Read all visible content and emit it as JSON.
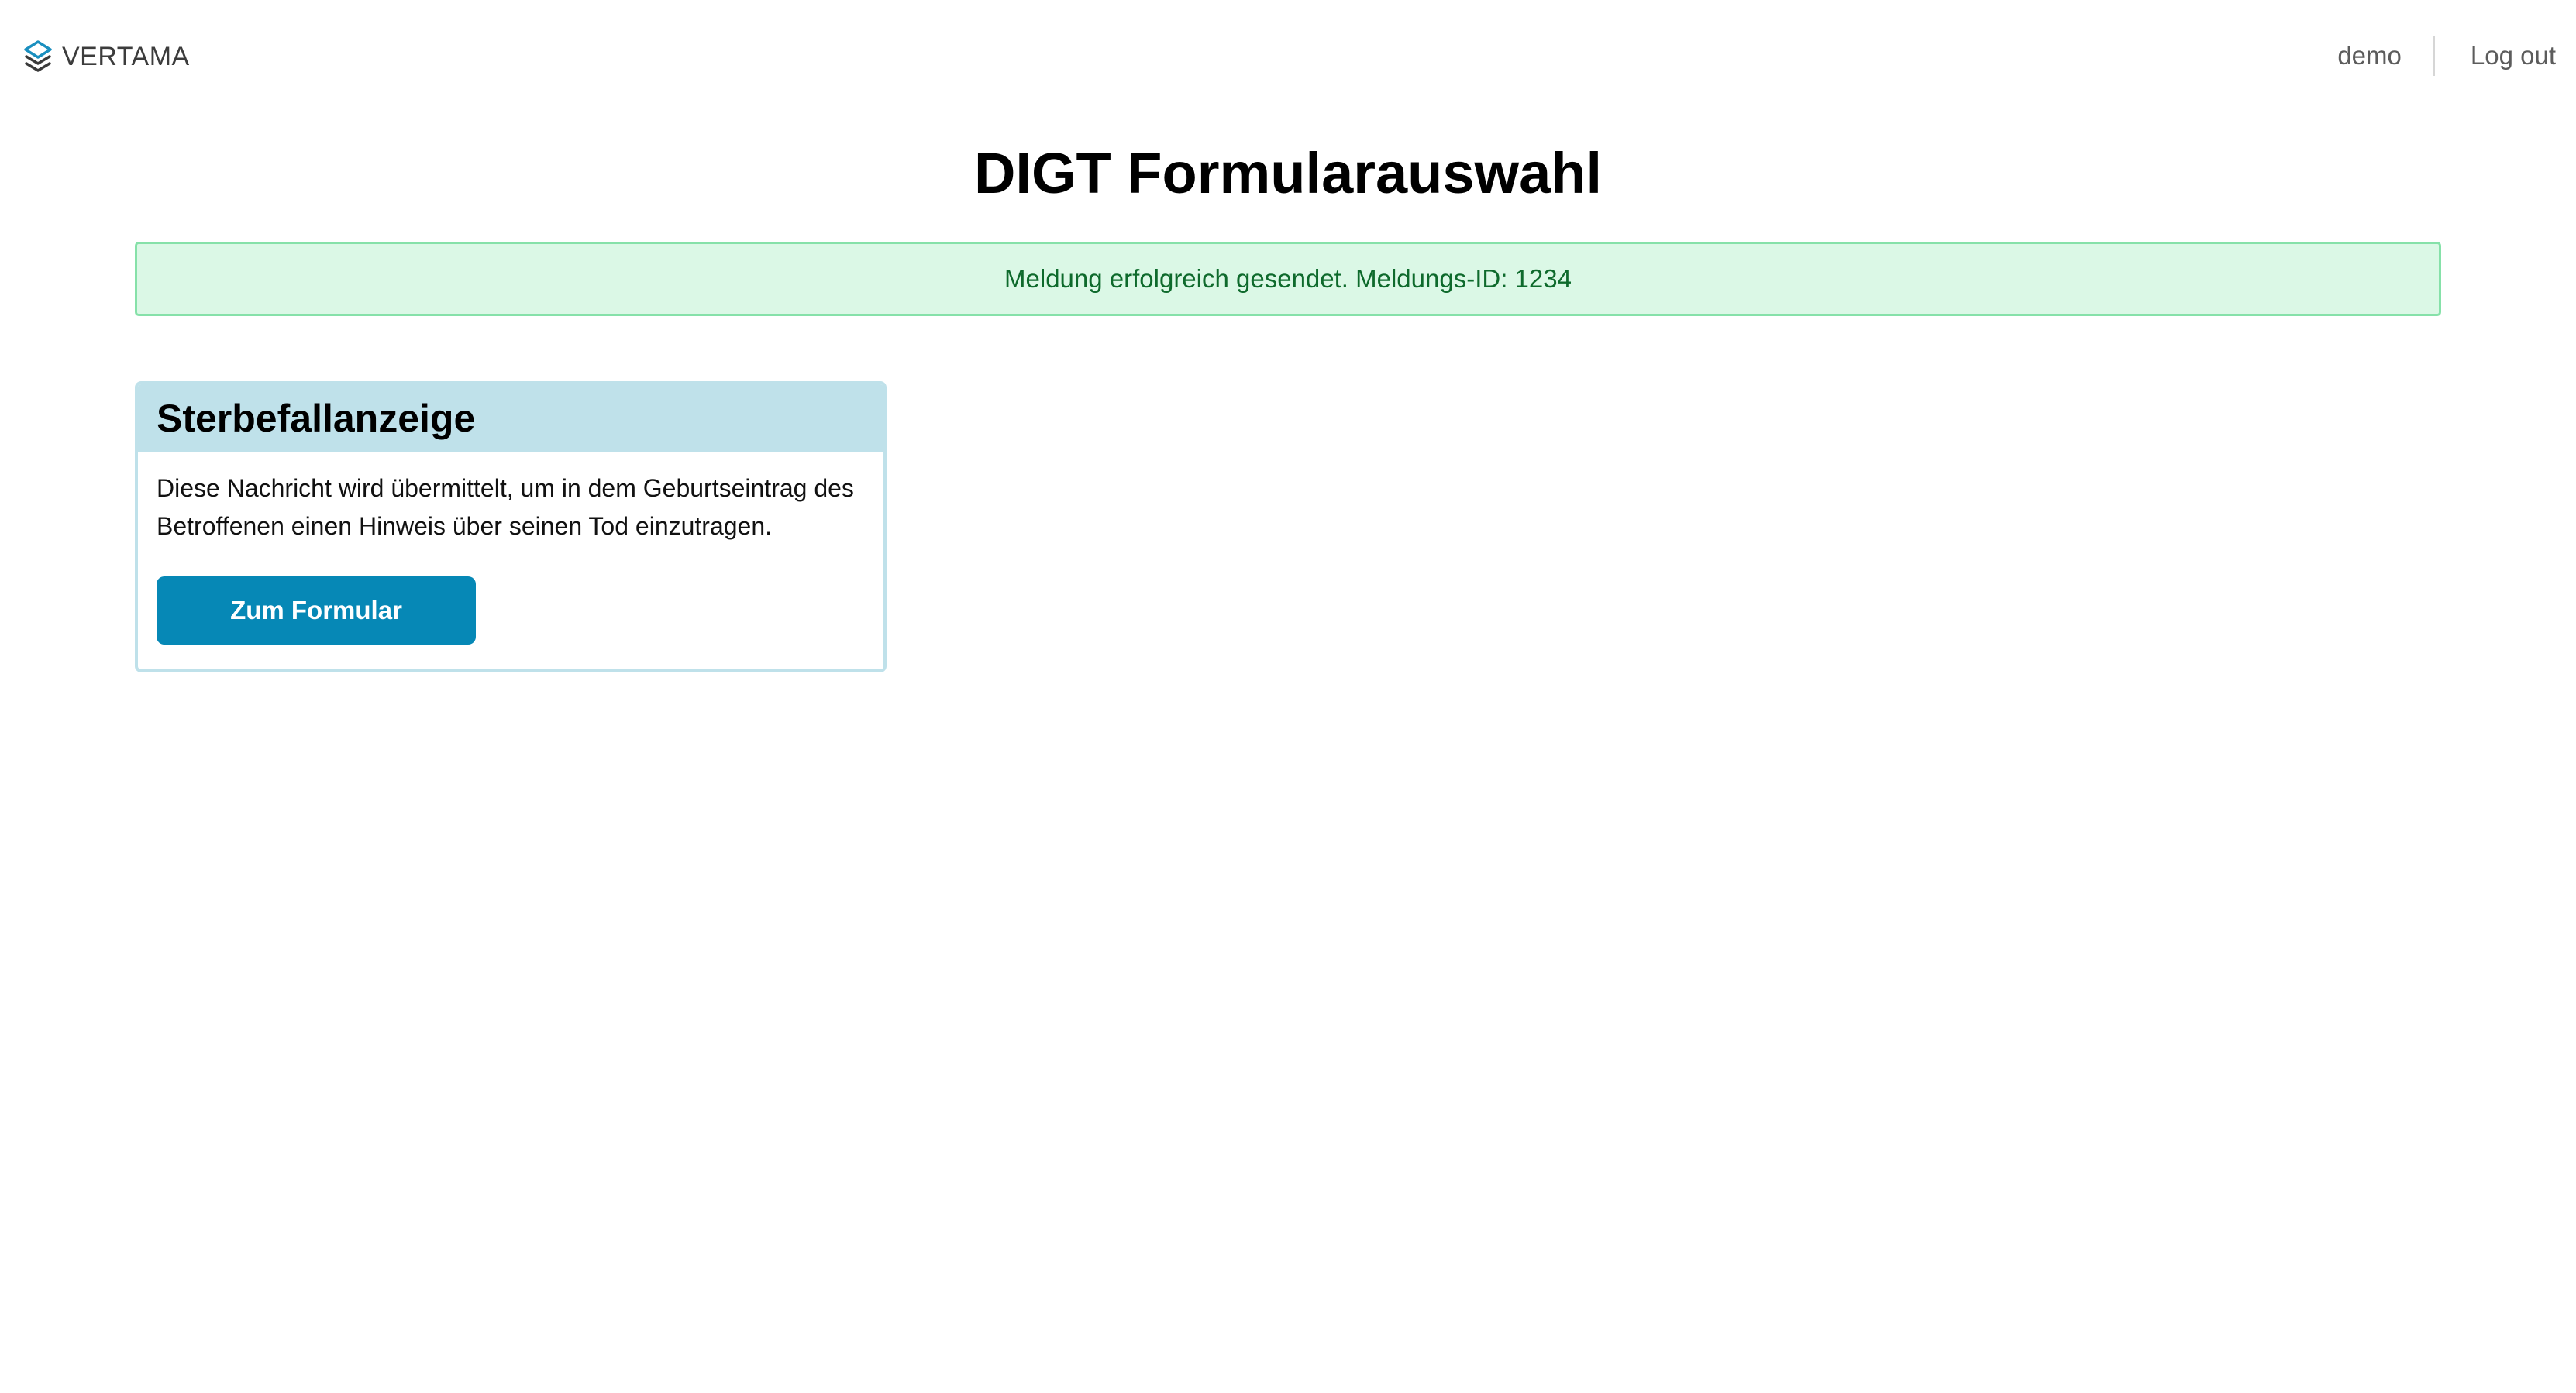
{
  "header": {
    "brand": "VERTAMA",
    "logo_icon": "vertama-layers-logo-icon",
    "user_label": "demo",
    "logout_label": "Log out"
  },
  "page": {
    "title": "DIGT Formularauswahl"
  },
  "alert": {
    "message": "Meldung erfolgreich gesendet. Meldungs-ID: 1234",
    "status": "success"
  },
  "cards": [
    {
      "title": "Sterbefallanzeige",
      "description": "Diese Nachricht wird übermittelt, um in dem Geburtseintrag des Betroffenen einen Hinweis über seinen Tod einzutragen.",
      "button_label": "Zum Formular"
    }
  ],
  "colors": {
    "accent": "#0688b6",
    "card_header": "#bfe1ea",
    "alert_background": "#dbf8e6",
    "alert_border": "#86e1a9",
    "alert_text": "#0e6a2c"
  }
}
